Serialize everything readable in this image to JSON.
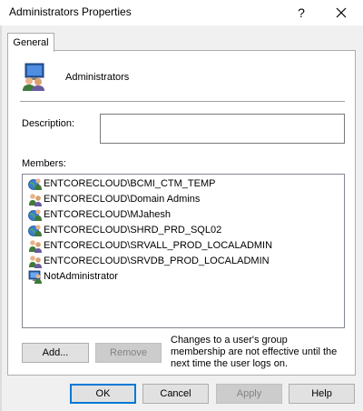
{
  "window": {
    "title": "Administrators Properties",
    "help_glyph": "?",
    "close_icon": "close-icon"
  },
  "tabs": [
    {
      "label": "General",
      "selected": true
    }
  ],
  "group": {
    "name": "Administrators",
    "icon": "group-computer-icon"
  },
  "description": {
    "label": "Description:",
    "value": ""
  },
  "members": {
    "label": "Members:",
    "items": [
      {
        "name": "ENTCORECLOUD\\BCMI_CTM_TEMP",
        "icon": "globe-user-icon"
      },
      {
        "name": "ENTCORECLOUD\\Domain Admins",
        "icon": "user-group-icon"
      },
      {
        "name": "ENTCORECLOUD\\MJahesh",
        "icon": "globe-user-icon"
      },
      {
        "name": "ENTCORECLOUD\\SHRD_PRD_SQL02",
        "icon": "globe-user-icon"
      },
      {
        "name": "ENTCORECLOUD\\SRVALL_PROD_LOCALADMIN",
        "icon": "user-group-icon"
      },
      {
        "name": "ENTCORECLOUD\\SRVDB_PROD_LOCALADMIN",
        "icon": "user-group-icon"
      },
      {
        "name": "NotAdministrator",
        "icon": "local-user-icon"
      }
    ]
  },
  "buttons": {
    "add": "Add...",
    "remove": "Remove",
    "ok": "OK",
    "cancel": "Cancel",
    "apply": "Apply",
    "help": "Help"
  },
  "note": "Changes to a user's group membership are not effective until the next time the user logs on.",
  "colors": {
    "accent": "#0078d7",
    "disabled_text": "#838383"
  }
}
